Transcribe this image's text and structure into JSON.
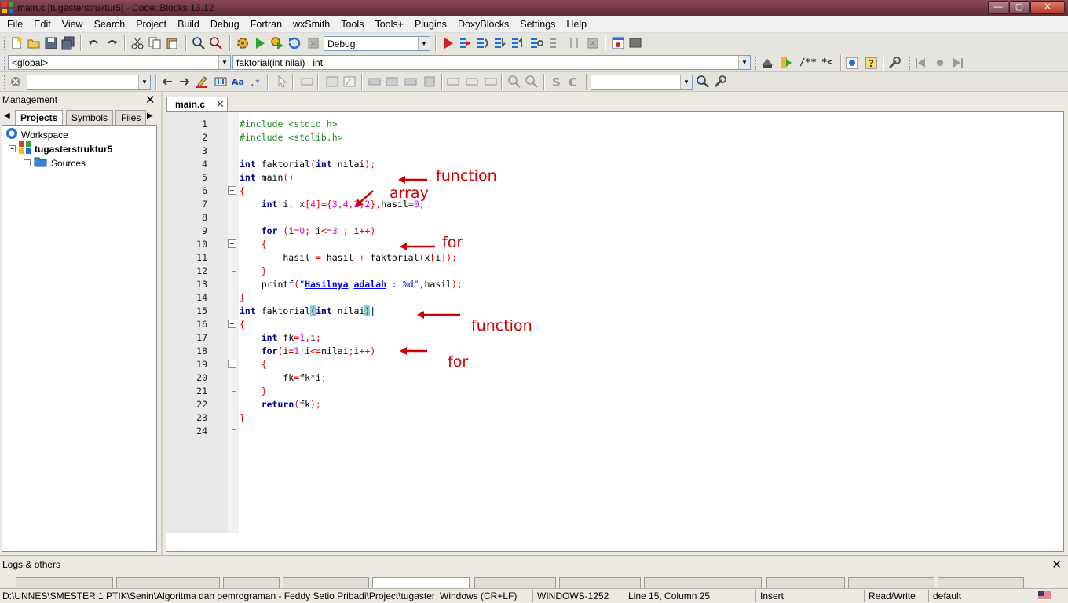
{
  "window": {
    "title": "main.c [tugasterstruktur5] - Code::Blocks 13.12",
    "minimize": "—",
    "maximize": "▢",
    "close": "✕"
  },
  "menu": [
    "File",
    "Edit",
    "View",
    "Search",
    "Project",
    "Build",
    "Debug",
    "Fortran",
    "wxSmith",
    "Tools",
    "Tools+",
    "Plugins",
    "DoxyBlocks",
    "Settings",
    "Help"
  ],
  "toolbar": {
    "build_target": "Debug",
    "scope": "<global>",
    "function": "faktorial(int nilai) : int",
    "doxy_comment": "/**",
    "doxy_inline": "*<",
    "search_value": "",
    "find_value": ""
  },
  "management": {
    "title": "Management",
    "tabs": [
      "Projects",
      "Symbols",
      "Files"
    ],
    "tree": {
      "workspace": "Workspace",
      "project": "tugasterstruktur5",
      "folder": "Sources"
    }
  },
  "editor": {
    "tab": "main.c",
    "lines": [
      {
        "n": "1",
        "html": "<span class=\"pp\">#include &lt;stdio.h&gt;</span>"
      },
      {
        "n": "2",
        "html": "<span class=\"pp\">#include &lt;stdlib.h&gt;</span>"
      },
      {
        "n": "3",
        "html": ""
      },
      {
        "n": "4",
        "html": "<span class=\"kw\">int</span> faktorial<span class=\"op\">(</span><span class=\"kw\">int</span> nilai<span class=\"op\">);</span>"
      },
      {
        "n": "5",
        "html": "<span class=\"kw\">int</span> main<span class=\"op\">()</span>"
      },
      {
        "n": "6",
        "html": "<span class=\"op\">{</span>"
      },
      {
        "n": "7",
        "html": "    <span class=\"kw\">int</span> i<span class=\"op\">,</span> x<span class=\"op\">[</span><span class=\"num\">4</span><span class=\"op\">]={</span><span class=\"num\">3</span><span class=\"op\">,</span><span class=\"num\">4</span><span class=\"op\">,</span><span class=\"num\">2</span><span class=\"op\">,</span><span class=\"num\">2</span><span class=\"op\">},</span>hasil<span class=\"op\">=</span><span class=\"num\">0</span><span class=\"op\">;</span>"
      },
      {
        "n": "8",
        "html": ""
      },
      {
        "n": "9",
        "html": "    <span class=\"kw\">for</span> <span class=\"op\">(</span>i<span class=\"op\">=</span><span class=\"num\">0</span><span class=\"op\">;</span> i<span class=\"op\">&lt;=</span><span class=\"num\">3</span> <span class=\"op\">;</span> i<span class=\"op\">++)</span>"
      },
      {
        "n": "10",
        "html": "    <span class=\"op\">{</span>"
      },
      {
        "n": "11",
        "html": "        hasil <span class=\"op\">=</span> hasil <span class=\"op\">+</span> faktorial<span class=\"op\">(</span>x<span class=\"op\">[</span>i<span class=\"op\">]);</span>"
      },
      {
        "n": "12",
        "html": "    <span class=\"op\">}</span>"
      },
      {
        "n": "13",
        "html": "    printf<span class=\"op\">(</span><span class=\"str\">\"<span class=\"und\">Hasilnya</span> <span class=\"und\">adalah</span> : %d\"</span><span class=\"op\">,</span>hasil<span class=\"op\">);</span>"
      },
      {
        "n": "14",
        "html": "<span class=\"op\">}</span>"
      },
      {
        "n": "15",
        "html": "<span class=\"kw\">int</span> faktorial<span class=\"op brace-hl\">(</span><span class=\"kw\">int</span> nilai<span class=\"op brace-hl\">)</span>|"
      },
      {
        "n": "16",
        "html": "<span class=\"op\">{</span>"
      },
      {
        "n": "17",
        "html": "    <span class=\"kw\">int</span> fk<span class=\"op\">=</span><span class=\"num\">1</span><span class=\"op\">,</span>i<span class=\"op\">;</span>"
      },
      {
        "n": "18",
        "html": "    <span class=\"kw\">for</span><span class=\"op\">(</span>i<span class=\"op\">=</span><span class=\"num\">1</span><span class=\"op\">;</span>i<span class=\"op\">&lt;=</span>nilai<span class=\"op\">;</span>i<span class=\"op\">++)</span>"
      },
      {
        "n": "19",
        "html": "    <span class=\"op\">{</span>"
      },
      {
        "n": "20",
        "html": "        fk<span class=\"op\">=</span>fk<span class=\"op\">*</span>i<span class=\"op\">;</span>"
      },
      {
        "n": "21",
        "html": "    <span class=\"op\">}</span>"
      },
      {
        "n": "22",
        "html": "    <span class=\"kw\">return</span><span class=\"op\">(</span>fk<span class=\"op\">);</span>"
      },
      {
        "n": "23",
        "html": "<span class=\"op\">}</span>"
      },
      {
        "n": "24",
        "html": ""
      }
    ],
    "annotations": [
      "function",
      "array",
      "for",
      "function",
      "for"
    ]
  },
  "logs": {
    "title": "Logs & others"
  },
  "status": {
    "path": "D:\\UNNES\\SMESTER 1 PTIK\\Senin\\Algoritma dan pemrograman - Feddy Setio Pribadi\\Project\\tugasterstru",
    "eol": "Windows (CR+LF)",
    "encoding": "WINDOWS-1252",
    "position": "Line 15, Column 25",
    "mode": "Insert",
    "access": "Read/Write",
    "profile": "default"
  },
  "colors": {
    "keyword": "#00008b",
    "preprocessor": "#228b22",
    "number": "#e600e6",
    "operator": "#e60000",
    "string": "#0000ff",
    "annotation": "#cc0000"
  }
}
